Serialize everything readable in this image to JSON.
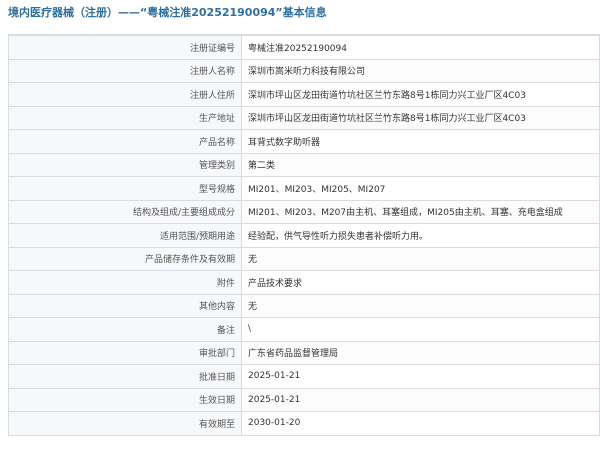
{
  "header": {
    "title": "境内医疗器械（注册）——“粤械注准20252190094”基本信息"
  },
  "rows": [
    {
      "label": "注册证编号",
      "value": "粤械注准20252190094"
    },
    {
      "label": "注册人名称",
      "value": "深圳市嵩米听力科技有限公司"
    },
    {
      "label": "注册人住所",
      "value": "深圳市坪山区龙田街道竹坑社区兰竹东路8号1栋同力兴工业厂区4C03"
    },
    {
      "label": "生产地址",
      "value": "深圳市坪山区龙田街道竹坑社区兰竹东路8号1栋同力兴工业厂区4C03"
    },
    {
      "label": "产品名称",
      "value": "耳背式数字助听器"
    },
    {
      "label": "管理类别",
      "value": "第二类"
    },
    {
      "label": "型号规格",
      "value": "MI201、MI203、MI205、MI207"
    },
    {
      "label": "结构及组成/主要组成成分",
      "value": "MI201、MI203、M207由主机、耳塞组成，MI205由主机、耳塞、充电盒组成"
    },
    {
      "label": "适用范围/预期用途",
      "value": "经验配，供气导性听力损失患者补偿听力用。"
    },
    {
      "label": "产品储存条件及有效期",
      "value": "无"
    },
    {
      "label": "附件",
      "value": "产品技术要求"
    },
    {
      "label": "其他内容",
      "value": "无"
    },
    {
      "label": "备注",
      "value": "\\"
    },
    {
      "label": "审批部门",
      "value": "广东省药品监督管理局"
    },
    {
      "label": "批准日期",
      "value": "2025-01-21"
    },
    {
      "label": "生效日期",
      "value": "2025-01-21"
    },
    {
      "label": "有效期至",
      "value": "2030-01-20"
    }
  ]
}
